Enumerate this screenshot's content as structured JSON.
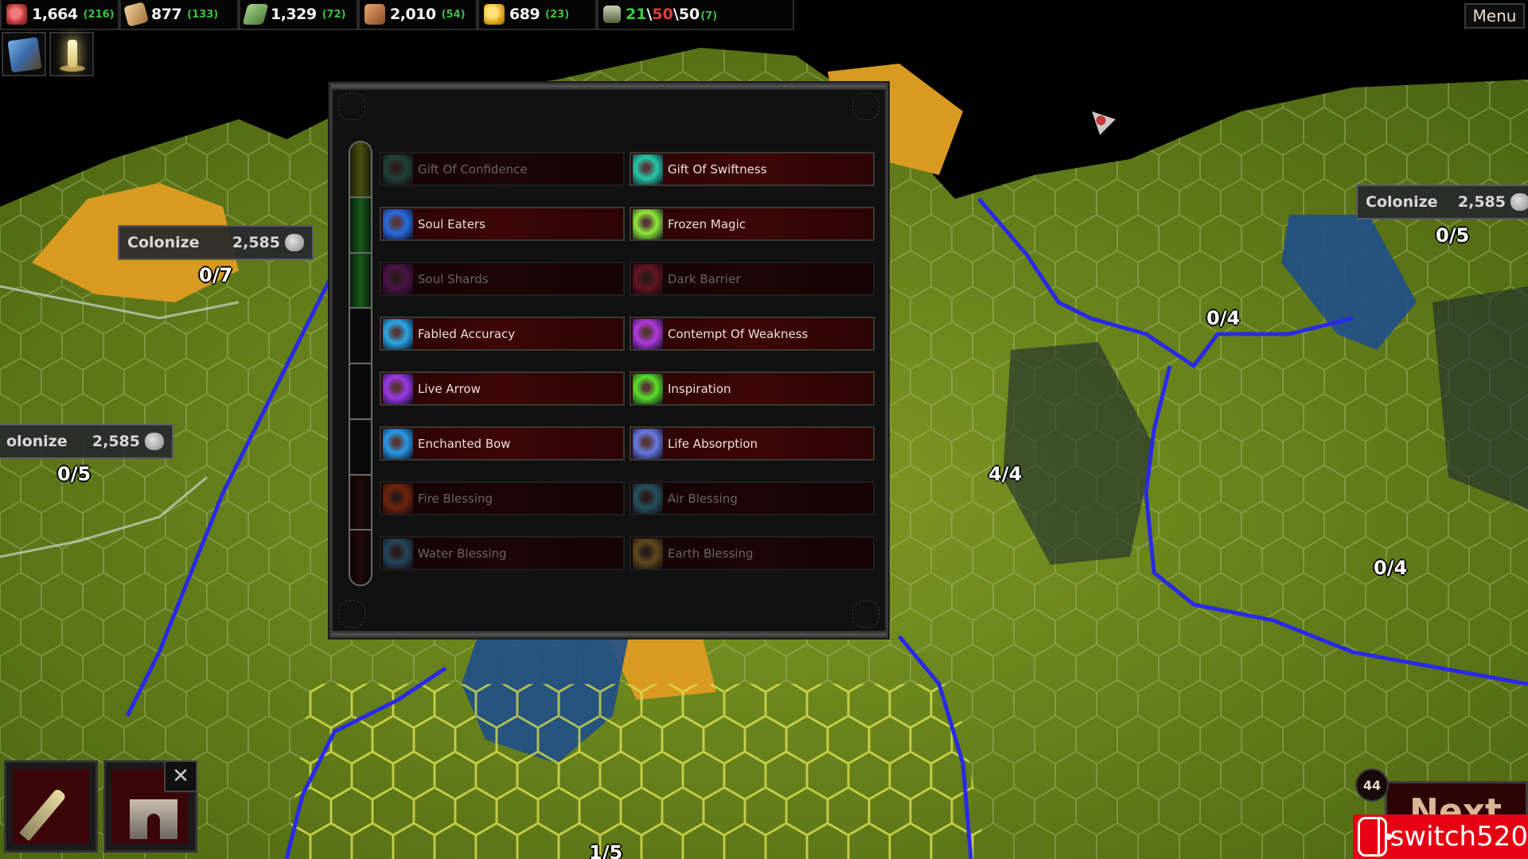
{
  "resources": [
    {
      "id": "food",
      "icon": "meat-icon",
      "value": "1,664",
      "delta": "(216)"
    },
    {
      "id": "wood",
      "icon": "wood-log-icon",
      "value": "877",
      "delta": "(133)"
    },
    {
      "id": "cloth",
      "icon": "cloth-roll-icon",
      "value": "1,329",
      "delta": "(72)"
    },
    {
      "id": "materials",
      "icon": "crate-icon",
      "value": "2,010",
      "delta": "(54)"
    },
    {
      "id": "gold",
      "icon": "gold-coins-icon",
      "value": "689",
      "delta": "(23)"
    }
  ],
  "population": {
    "icon": "people-icon",
    "current": "21",
    "sep1": "\\",
    "limit": "50",
    "sep2": "\\",
    "max": "50",
    "delta": "(7)"
  },
  "menu_label": "Menu",
  "quick_buttons": [
    {
      "icon": "spellbook-icon"
    },
    {
      "icon": "candle-icon"
    }
  ],
  "spell_panel": {
    "progress_fraction": 0.375,
    "progress_segments": 8,
    "spells": [
      {
        "name": "Gift Of Confidence",
        "icon": "confidence-icon",
        "state": "locked",
        "color": "#2f8f7a"
      },
      {
        "name": "Gift Of Swiftness",
        "icon": "swiftness-icon",
        "state": "available",
        "color": "#28c8a8"
      },
      {
        "name": "Soul Eaters",
        "icon": "soul-eaters-icon",
        "state": "available",
        "color": "#2a6de0"
      },
      {
        "name": "Frozen Magic",
        "icon": "frozen-magic-icon",
        "state": "available",
        "color": "#8ee83a"
      },
      {
        "name": "Soul Shards",
        "icon": "soul-shards-icon",
        "state": "locked",
        "color": "#8a2c9a"
      },
      {
        "name": "Dark Barrier",
        "icon": "dark-barrier-icon",
        "state": "locked",
        "color": "#c42a4a"
      },
      {
        "name": "Fabled Accuracy",
        "icon": "target-icon",
        "state": "available",
        "color": "#2aa8e8"
      },
      {
        "name": "Contempt Of Weakness",
        "icon": "contempt-icon",
        "state": "available",
        "color": "#b03ae0"
      },
      {
        "name": "Live Arrow",
        "icon": "live-arrow-icon",
        "state": "available",
        "color": "#9a3ae8"
      },
      {
        "name": "Inspiration",
        "icon": "inspiration-icon",
        "state": "available",
        "color": "#5ae028"
      },
      {
        "name": "Enchanted Bow",
        "icon": "enchanted-bow-icon",
        "state": "available",
        "color": "#2a9ae8"
      },
      {
        "name": "Life Absorption",
        "icon": "life-absorption-icon",
        "state": "available",
        "color": "#6a7ae0"
      },
      {
        "name": "Fire Blessing",
        "icon": "fire-icon",
        "state": "locked",
        "color": "#e0501a"
      },
      {
        "name": "Air Blessing",
        "icon": "air-icon",
        "state": "locked",
        "color": "#3ab0c8"
      },
      {
        "name": "Water Blessing",
        "icon": "water-icon",
        "state": "locked",
        "color": "#3a98c8"
      },
      {
        "name": "Earth Blessing",
        "icon": "earth-icon",
        "state": "locked",
        "color": "#b8a040"
      }
    ]
  },
  "colonize_labels": [
    {
      "label": "Colonize",
      "cost": "2,585",
      "count": "0/7"
    },
    {
      "label": "olonize",
      "cost": "2,585",
      "count": "0/5"
    },
    {
      "label": "Colonize",
      "cost": "2,585",
      "count": "0/5"
    }
  ],
  "map_counts": [
    "0/4",
    "4/4",
    "0/4",
    "1/5"
  ],
  "bottom_left": {
    "buttons": [
      {
        "icon": "sword-icon"
      },
      {
        "icon": "castle-icon"
      }
    ],
    "close_label": "✕"
  },
  "turn_number": "44",
  "next_label": "Next",
  "watermark": "switch520"
}
